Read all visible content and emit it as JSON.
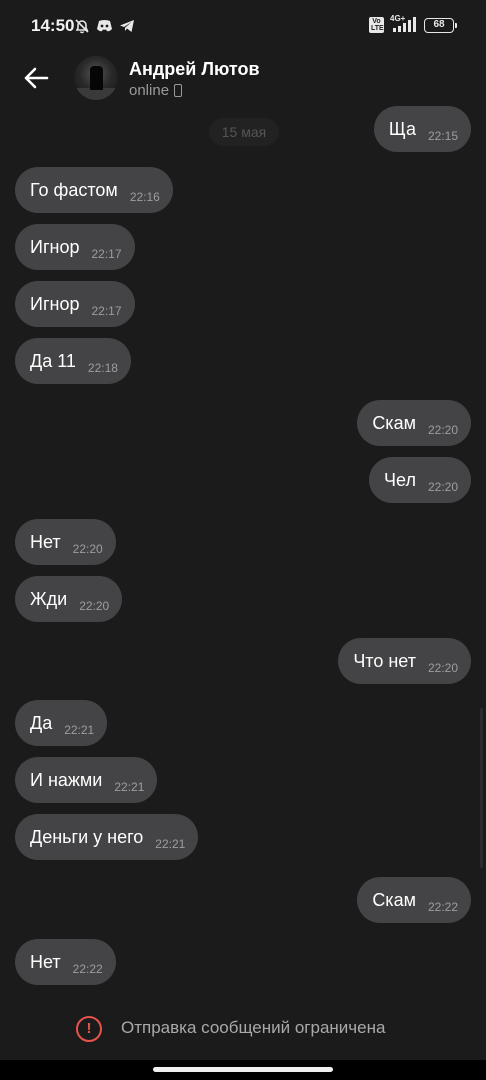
{
  "status_bar": {
    "time": "14:50",
    "left_icons": [
      "muted-bell-icon",
      "discord-icon",
      "telegram-icon"
    ],
    "volte": "Vo LTE",
    "network": "4G+",
    "battery": "68"
  },
  "header": {
    "contact_name": "Андрей Лютов",
    "status": "online",
    "status_icon": "phone-icon"
  },
  "chat": {
    "date_chip": "15 мая",
    "messages": [
      {
        "side": "out",
        "text": "Ща",
        "time": "22:15"
      },
      {
        "side": "in",
        "text": "Го фастом",
        "time": "22:16"
      },
      {
        "side": "in",
        "text": "Игнор",
        "time": "22:17"
      },
      {
        "side": "in",
        "text": "Игнор",
        "time": "22:17"
      },
      {
        "side": "in",
        "text": "Да 11",
        "time": "22:18"
      },
      {
        "side": "out",
        "text": "Скам",
        "time": "22:20"
      },
      {
        "side": "out",
        "text": "Чел",
        "time": "22:20"
      },
      {
        "side": "in",
        "text": "Нет",
        "time": "22:20"
      },
      {
        "side": "in",
        "text": "Жди",
        "time": "22:20"
      },
      {
        "side": "out",
        "text": "Что нет",
        "time": "22:20"
      },
      {
        "side": "in",
        "text": "Да",
        "time": "22:21"
      },
      {
        "side": "in",
        "text": "И нажми",
        "time": "22:21"
      },
      {
        "side": "in",
        "text": "Деньги у него",
        "time": "22:21"
      },
      {
        "side": "out",
        "text": "Скам",
        "time": "22:22"
      },
      {
        "side": "in",
        "text": "Нет",
        "time": "22:22"
      }
    ]
  },
  "footer": {
    "restriction_text": "Отправка сообщений ограничена",
    "restriction_icon": "alert-circle-icon"
  },
  "colors": {
    "background": "#1b1b1c",
    "bubble": "#444446",
    "alert": "#e5534b"
  }
}
